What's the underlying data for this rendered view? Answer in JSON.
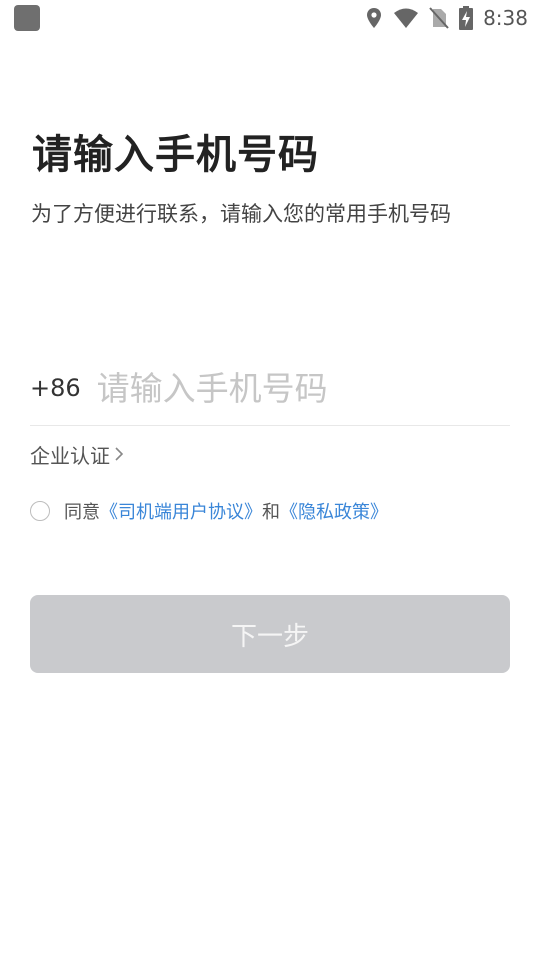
{
  "status_bar": {
    "time": "8:38",
    "icons": [
      "location-icon",
      "wifi-icon",
      "no-sim-icon",
      "battery-charging-icon"
    ]
  },
  "header": {
    "title": "请输入手机号码",
    "subtitle": "为了方便进行联系，请输入您的常用手机号码"
  },
  "phone": {
    "country_code": "+86",
    "placeholder": "请输入手机号码",
    "value": ""
  },
  "enterprise": {
    "label": "企业认证",
    "chevron": "›"
  },
  "agreement": {
    "prefix": "同意",
    "user_agreement": "《司机端用户协议》",
    "and": "和",
    "privacy_policy": "《隐私政策》",
    "checked": false
  },
  "next_button": {
    "label": "下一步",
    "enabled": false
  },
  "colors": {
    "link": "#3a86d8",
    "button_disabled": "#c9cacd",
    "placeholder": "#c6c6c6"
  }
}
